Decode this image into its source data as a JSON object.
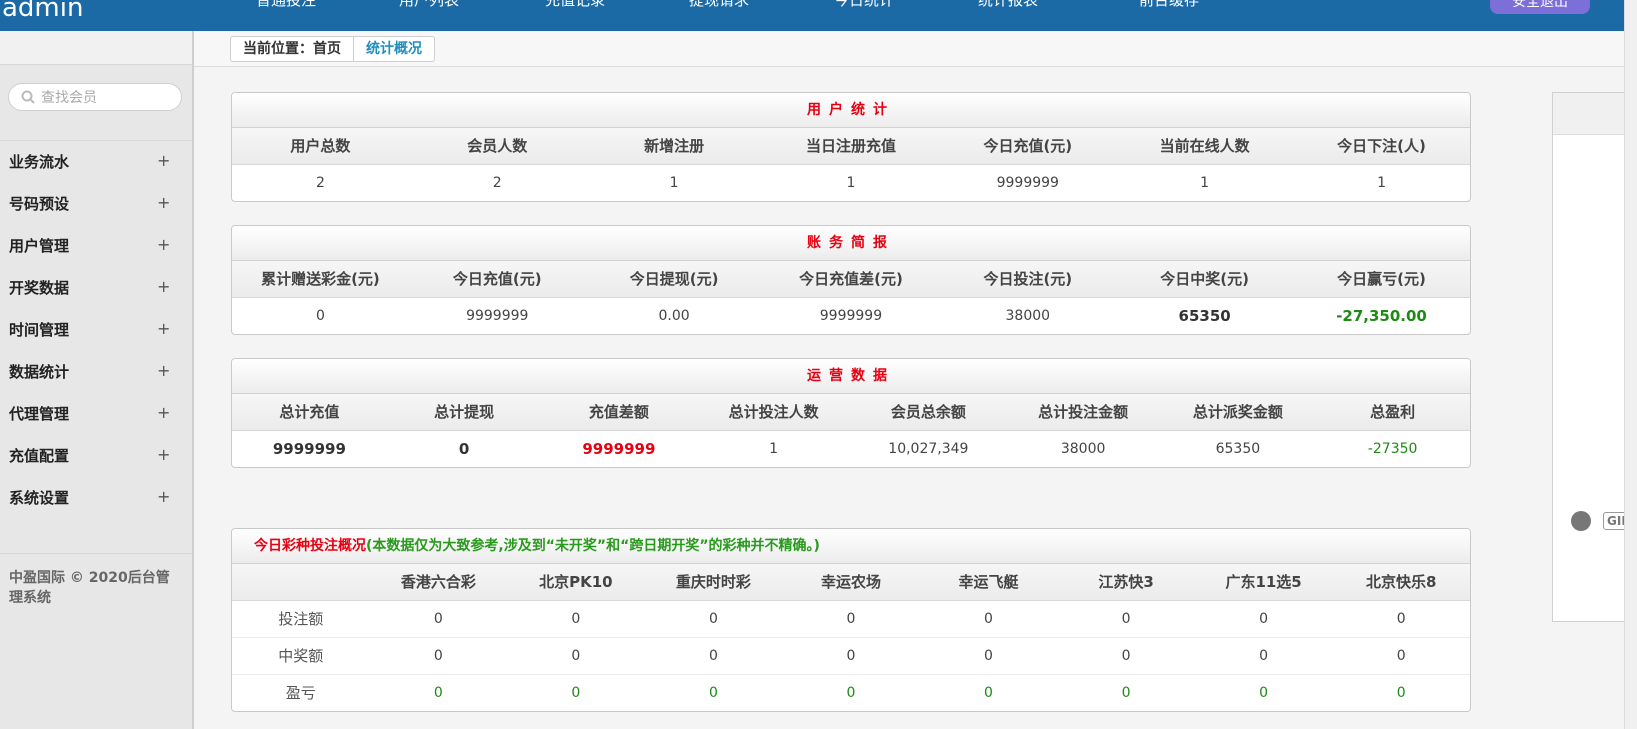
{
  "brand": "admin",
  "topnav": {
    "items": [
      "普通投注",
      "用户列表",
      "充值记录",
      "提现请求",
      "今日统计",
      "统计报表",
      "前台缓存"
    ],
    "logout_label": "安全退出"
  },
  "sidebar": {
    "search_placeholder": "查找会员",
    "items": [
      {
        "label": "业务流水",
        "toggle": "+"
      },
      {
        "label": "号码预设",
        "toggle": "+"
      },
      {
        "label": "用户管理",
        "toggle": "+"
      },
      {
        "label": "开奖数据",
        "toggle": "+"
      },
      {
        "label": "时间管理",
        "toggle": "+"
      },
      {
        "label": "数据统计",
        "toggle": "+"
      },
      {
        "label": "代理管理",
        "toggle": "+"
      },
      {
        "label": "充值配置",
        "toggle": "+"
      },
      {
        "label": "系统设置",
        "toggle": "+"
      }
    ],
    "footer": "中盈国际 © 2020后台管理系统"
  },
  "breadcrumb": {
    "current_label": "当前位置：首页",
    "active": "统计概况"
  },
  "user_stats": {
    "title": "用户统计",
    "headers": [
      "用户总数",
      "会员人数",
      "新增注册",
      "当日注册充值",
      "今日充值(元)",
      "当前在线人数",
      "今日下注(人)"
    ],
    "values": [
      "2",
      "2",
      "1",
      "1",
      "9999999",
      "1",
      "1"
    ]
  },
  "finance": {
    "title": "账务简报",
    "headers": [
      "累计赠送彩金(元)",
      "今日充值(元)",
      "今日提现(元)",
      "今日充值差(元)",
      "今日投注(元)",
      "今日中奖(元)",
      "今日赢亏(元)"
    ],
    "values": [
      "0",
      "9999999",
      "0.00",
      "9999999",
      "38000",
      "65350",
      "-27,350.00"
    ]
  },
  "operations": {
    "title": "运营数据",
    "headers": [
      "总计充值",
      "总计提现",
      "充值差额",
      "总计投注人数",
      "会员总余额",
      "总计投注金额",
      "总计派奖金额",
      "总盈利"
    ],
    "values": [
      "9999999",
      "0",
      "9999999",
      "1",
      "10,027,349",
      "38000",
      "65350",
      "-27350"
    ]
  },
  "games": {
    "title": "今日彩种投注概况",
    "note": "(本数据仅为大致参考,涉及到“未开奖”和“跨日期开奖”的彩种并不精确。)",
    "headers": [
      "",
      "香港六合彩",
      "北京PK10",
      "重庆时时彩",
      "幸运农场",
      "幸运飞艇",
      "江苏快3",
      "广东11选5",
      "北京快乐8"
    ],
    "rows": [
      {
        "label": "投注额",
        "values": [
          "0",
          "0",
          "0",
          "0",
          "0",
          "0",
          "0",
          "0"
        ]
      },
      {
        "label": "中奖额",
        "values": [
          "0",
          "0",
          "0",
          "0",
          "0",
          "0",
          "0",
          "0"
        ]
      },
      {
        "label": "盈亏",
        "values": [
          "0",
          "0",
          "0",
          "0",
          "0",
          "0",
          "0",
          "0"
        ]
      }
    ]
  },
  "widget": {
    "gif_label": "GIF"
  },
  "colors": {
    "topbar": "#1b6aa6",
    "title_red": "#e60012",
    "profit_green": "#1d8a13"
  }
}
